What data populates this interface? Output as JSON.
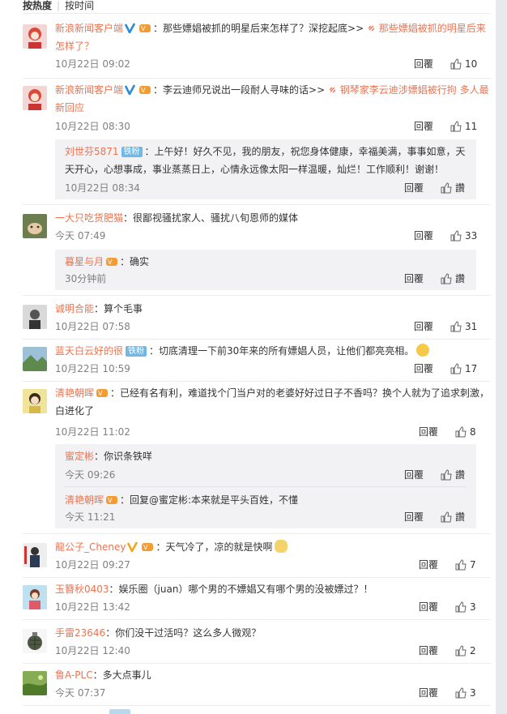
{
  "sort": {
    "hot": "按热度",
    "time": "按时间"
  },
  "actions": {
    "reply": "回覆",
    "like_placeholder": "讚"
  },
  "comments": [
    {
      "user": "新浪新闻客户端",
      "text": "：那些嫖娼被抓的明星后来怎样了？深挖起底>>",
      "link": "那些嫖娼被抓的明星后来怎样了？",
      "time": "10月22日 09:02",
      "likes": "10"
    },
    {
      "user": "新浪新闻客户端",
      "text": "：李云迪师兄说出一段耐人寻味的话>>",
      "link": "钢琴家李云迪涉嫖娼被行拘 多人最新回应",
      "time": "10月22日 08:30",
      "likes": "11",
      "replies": [
        {
          "user": "刘世芬5871",
          "badge": "铁粉",
          "text": "：上午好！好久不见，我的朋友，祝您身体健康，幸福美满，事事如意，天天开心，心想事成，事业蒸蒸日上，心情永远像太阳一样温暖，灿烂！工作顺利！谢谢！",
          "time": "10月22日 08:34",
          "likes": "讚"
        }
      ]
    },
    {
      "user": "一大只吃货肥猫",
      "text": "：很鄙视骚扰家人、骚扰八旬恩师的媒体",
      "time": "今天 07:49",
      "likes": "33",
      "replies": [
        {
          "user": "暮星与月",
          "text": "：确实",
          "time": "30分钟前",
          "likes": "讚"
        }
      ]
    },
    {
      "user": "诚明合能",
      "text": "：算个毛事",
      "time": "10月22日 07:58",
      "likes": "31"
    },
    {
      "user": "蓝天白云好的很",
      "badge": "铁粉",
      "text": "：切底清理一下前30年来的所有嫖娼人员，让他们都亮亮相。",
      "time": "10月22日 10:59",
      "likes": "17"
    },
    {
      "user": "清艳朝晖",
      "text": "：已经有名有利，难道找个门当户对的老婆好好过日子不香吗？换个人就为了追求刺激，白进化了",
      "time": "10月22日 11:02",
      "likes": "8",
      "replies": [
        {
          "user": "蜜定彬",
          "text": "：你识条铁咩",
          "time": "今天 09:26",
          "likes": "讚"
        },
        {
          "user": "清艳朝晖",
          "text": "：回复@蜜定彬:本来就是平头百姓，不懂",
          "time": "今天 11:21",
          "likes": "讚"
        }
      ]
    },
    {
      "user": "龍公子_Cheney",
      "text": "：天气冷了，凉的就是快啊",
      "time": "10月22日 09:27",
      "likes": "7"
    },
    {
      "user": "玉簪秋0403",
      "text": "：娱乐圈（juan）哪个男的不嫖娼又有哪个男的没被嫖过？！",
      "time": "10月22日 13:42",
      "likes": "3"
    },
    {
      "user": "手雷23646",
      "text": "：你们没干过活吗？这么多人微观？",
      "time": "10月22日 12:40",
      "likes": "2"
    },
    {
      "user": "鲁A-PLC",
      "text": "：多大点事儿",
      "time": "今天 07:37",
      "likes": "3"
    }
  ],
  "colors": {
    "username": "#eb7350",
    "time": "#808080",
    "reply_bg": "#f2f2f5",
    "badge_tie": "#6fb8e8"
  }
}
